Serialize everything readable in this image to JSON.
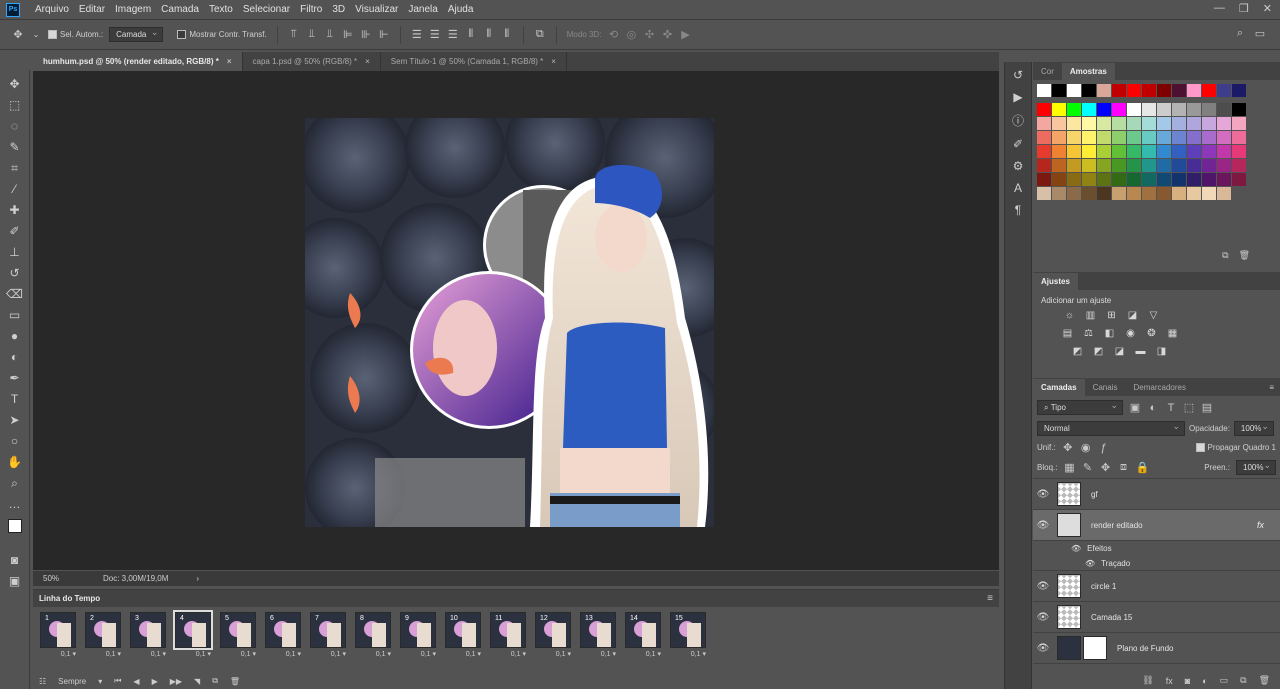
{
  "menubar": {
    "logo": "Ps",
    "items": [
      "Arquivo",
      "Editar",
      "Imagem",
      "Camada",
      "Texto",
      "Selecionar",
      "Filtro",
      "3D",
      "Visualizar",
      "Janela",
      "Ajuda"
    ]
  },
  "options": {
    "auto_select_label": "Sel. Autom.:",
    "auto_select_value": "Camada",
    "show_transform_label": "Mostrar Contr. Transf.",
    "mode_3d_label": "Modo 3D:"
  },
  "tabs": [
    {
      "label": "humhum.psd @ 50% (render editado, RGB/8) *",
      "active": true
    },
    {
      "label": "capa 1.psd @ 50% (RGB/8) *",
      "active": false
    },
    {
      "label": "Sem Título-1 @ 50% (Camada 1, RGB/8) *",
      "active": false
    }
  ],
  "tab_close": "×",
  "status": {
    "zoom": "50%",
    "doc": "Doc: 3,00M/19,0M",
    "arrow": "›"
  },
  "timeline": {
    "title": "Linha do Tempo",
    "selected_frame": 4,
    "frames": [
      {
        "num": "1",
        "delay": "0,1"
      },
      {
        "num": "2",
        "delay": "0,1"
      },
      {
        "num": "3",
        "delay": "0,1"
      },
      {
        "num": "4",
        "delay": "0,1"
      },
      {
        "num": "5",
        "delay": "0,1"
      },
      {
        "num": "6",
        "delay": "0,1"
      },
      {
        "num": "7",
        "delay": "0,1"
      },
      {
        "num": "8",
        "delay": "0,1"
      },
      {
        "num": "9",
        "delay": "0,1"
      },
      {
        "num": "10",
        "delay": "0,1"
      },
      {
        "num": "11",
        "delay": "0,1"
      },
      {
        "num": "12",
        "delay": "0,1"
      },
      {
        "num": "13",
        "delay": "0,1"
      },
      {
        "num": "14",
        "delay": "0,1"
      },
      {
        "num": "15",
        "delay": "0,1"
      }
    ],
    "loop_value": "Sempre"
  },
  "color_panel": {
    "tabs": [
      "Cor",
      "Amostras"
    ],
    "swatch_rows": [
      [
        "#ffffff",
        "#000000",
        "#ffffff",
        "#000000",
        "#d9a69a",
        "#c00000",
        "#ff0000",
        "#c00000",
        "#7f0000",
        "#4c1130",
        "#ff99cc",
        "#ff0000",
        "#3d3d8c",
        "#1a1a66"
      ],
      [
        "#ff0000",
        "#ffff00",
        "#00ff00",
        "#00ffff",
        "#0000ff",
        "#ff00ff",
        "#ffffff",
        "#e6e6e6",
        "#cccccc",
        "#b3b3b3",
        "#999999",
        "#808080",
        "#4d4d4d",
        "#000000"
      ],
      [
        "#f4a6a0",
        "#f8c7a0",
        "#fbe6a2",
        "#fff9a6",
        "#d7e8a0",
        "#b5dea0",
        "#a6d9b7",
        "#a3dcd8",
        "#a3c8e8",
        "#a3b0e0",
        "#b0a6de",
        "#c8a6de",
        "#e6a6d8",
        "#f4a6c0"
      ],
      [
        "#ee6b5f",
        "#f3a467",
        "#f8d56a",
        "#fff36d",
        "#c0db6a",
        "#8ccf6c",
        "#6cc98e",
        "#68cbc3",
        "#67a9db",
        "#6b85d0",
        "#8470cc",
        "#a86ccc",
        "#d46cc0",
        "#ee6c9a"
      ],
      [
        "#e53a2c",
        "#ee8232",
        "#f5c533",
        "#ffee35",
        "#a8cf35",
        "#62bf38",
        "#36b967",
        "#33bbb0",
        "#3189cf",
        "#3460c0",
        "#5d3fbb",
        "#8d38bb",
        "#c238aa",
        "#e53a77"
      ],
      [
        "#b5271c",
        "#bc6420",
        "#c49b21",
        "#ccbd22",
        "#85a522",
        "#4a9824",
        "#249449",
        "#21968c",
        "#1e6ba6",
        "#214b99",
        "#472d95",
        "#702495",
        "#992485",
        "#b5275c"
      ],
      [
        "#7d1810",
        "#834412",
        "#886b13",
        "#8e8314",
        "#5c7314",
        "#336a15",
        "#15682f",
        "#126961",
        "#104a74",
        "#12336b",
        "#301e69",
        "#4e1568",
        "#6b155d",
        "#7d1840"
      ],
      [
        "#d8c0a8",
        "#a88a6a",
        "#8a6a48",
        "#6b4e30",
        "#4d3620",
        "#c8a070",
        "#b88850",
        "#a07040",
        "#885830",
        "#d8b080",
        "#e8c8a0",
        "#f0d8b8",
        "#d8b898"
      ]
    ]
  },
  "adjust_panel": {
    "title": "Ajustes",
    "subtitle": "Adicionar um ajuste"
  },
  "layers_panel": {
    "tabs": [
      "Camadas",
      "Canais",
      "Demarcadores"
    ],
    "filter_label": "Tipo",
    "blend_mode": "Normal",
    "opacity_label": "Opacidade:",
    "opacity_value": "100%",
    "unify_label": "Unif.:",
    "propagate_label": "Propagar Quadro 1",
    "lock_label": "Bloq.:",
    "fill_label": "Preen.:",
    "fill_value": "100%",
    "fx_label": "fx",
    "layers": [
      {
        "name": "gf",
        "active": false
      },
      {
        "name": "render editado",
        "active": true
      },
      {
        "name": "circle 1",
        "active": false
      },
      {
        "name": "Camada 15",
        "active": false
      },
      {
        "name": "Plano de Fundo",
        "active": false
      }
    ],
    "effects_label": "Efeitos",
    "stroke_label": "Traçado"
  }
}
